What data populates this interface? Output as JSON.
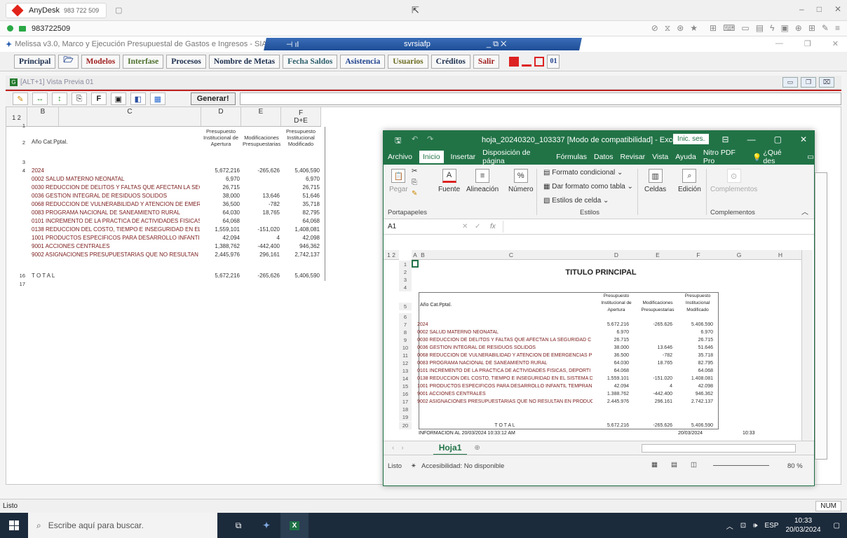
{
  "anydesk": {
    "app_name": "AnyDesk",
    "tab_id": "983 722 509",
    "session_id": "983722509"
  },
  "melissa": {
    "window_title": "Melissa v3.0, Marco y Ejecución Presupuestal de Gastos e Ingresos - SIAF  [compilación",
    "rdp_host": "svrsiafp",
    "menu": {
      "principal": "Principal",
      "modelos": "Modelos",
      "interfase": "Interfase",
      "procesos": "Procesos",
      "nombre_metas": "Nombre de Metas",
      "fecha_saldos": "Fecha Saldos",
      "asistencia": "Asistencia",
      "usuarios": "Usuarios",
      "creditos": "Créditos",
      "salir": "Salir",
      "badge": "01"
    },
    "inner_title": "[ALT+1] Vista Previa 01",
    "generate_button": "Generar!",
    "status": "Listo",
    "num_indicator": "NUM"
  },
  "grid": {
    "outline_levels": [
      "1",
      "2"
    ],
    "col_headers": {
      "b": "B",
      "c": "C",
      "d": "D",
      "e": "E",
      "f": "F",
      "f_sub": "D+E"
    },
    "header_labels": {
      "cat": "Año  Cat.Pptal.",
      "d": "Presupuesto Institucional de Apertura",
      "e": "Modificaciones Presupuestarias",
      "f": "Presupuesto Institucional Modificado"
    },
    "row_numbers": {
      "r1": "1",
      "r2": "2",
      "r3": "3",
      "r4": "4",
      "r16": "16",
      "r17": "17"
    },
    "rows": [
      {
        "code": "2024",
        "desc": "",
        "d": "5,672,216",
        "e": "-265,626",
        "f": "5,406,590"
      },
      {
        "code": "0002",
        "desc": "SALUD MATERNO NEONATAL",
        "d": "6,970",
        "e": "",
        "f": "6,970"
      },
      {
        "code": "0030",
        "desc": "REDUCCION DE DELITOS Y FALTAS QUE AFECTAN LA SEGUI",
        "d": "26,715",
        "e": "",
        "f": "26,715"
      },
      {
        "code": "0036",
        "desc": "GESTION INTEGRAL DE RESIDUOS SOLIDOS",
        "d": "38,000",
        "e": "13,646",
        "f": "51,646"
      },
      {
        "code": "0068",
        "desc": "REDUCCION DE VULNERABILIDAD Y ATENCION DE EMERGEN",
        "d": "36,500",
        "e": "-782",
        "f": "35,718"
      },
      {
        "code": "0083",
        "desc": "PROGRAMA NACIONAL DE SANEAMIENTO RURAL",
        "d": "64,030",
        "e": "18,765",
        "f": "82,795"
      },
      {
        "code": "0101",
        "desc": "INCREMENTO DE LA PRACTICA DE ACTIVIDADES FISICAS, DE",
        "d": "64,068",
        "e": "",
        "f": "64,068"
      },
      {
        "code": "0138",
        "desc": "REDUCCION DEL COSTO, TIEMPO E INSEGURIDAD EN EL SIS",
        "d": "1,559,101",
        "e": "-151,020",
        "f": "1,408,081"
      },
      {
        "code": "1001",
        "desc": "PRODUCTOS ESPECIFICOS PARA DESARROLLO INFANTIL TE",
        "d": "42,094",
        "e": "4",
        "f": "42,098"
      },
      {
        "code": "9001",
        "desc": "ACCIONES CENTRALES",
        "d": "1,388,762",
        "e": "-442,400",
        "f": "946,362"
      },
      {
        "code": "9002",
        "desc": "ASIGNACIONES PRESUPUESTARIAS QUE NO RESULTAN EN I",
        "d": "2,445,976",
        "e": "296,161",
        "f": "2,742,137"
      }
    ],
    "total": {
      "label": "T O T A L",
      "d": "5,672,216",
      "e": "-265,626",
      "f": "5,406,590"
    }
  },
  "excel": {
    "title": "hoja_20240320_103337  [Modo de compatibilidad]  -  Excel",
    "signin": "Inic. ses.",
    "tabs": [
      "Archivo",
      "Inicio",
      "Insertar",
      "Disposición de página",
      "Fórmulas",
      "Datos",
      "Revisar",
      "Vista",
      "Ayuda",
      "Nitro PDF Pro",
      "¿Qué des"
    ],
    "ribbon": {
      "pegar": "Pegar",
      "fuente": "Fuente",
      "alineacion": "Alineación",
      "numero": "Número",
      "formato_condicional": "Formato condicional",
      "dar_formato": "Dar formato como tabla",
      "estilos_celda": "Estilos de celda",
      "celdas": "Celdas",
      "edicion": "Edición",
      "complementos": "Complementos",
      "portapapeles": "Portapapeles",
      "estilos": "Estilos",
      "complementos_group": "Complementos"
    },
    "name_box": "A1",
    "fx": "fx",
    "outline_levels": [
      "1",
      "2"
    ],
    "columns": [
      "A",
      "B",
      "C",
      "D",
      "E",
      "F",
      "G",
      "H"
    ],
    "main_title": "TITULO PRINCIPAL",
    "header_labels": {
      "cat": "Año  Cat.Pptal.",
      "d": "Presupuesto Institucional de Apertura",
      "e": "Modificaciones Presupuestarias",
      "f": "Presupuesto Institucional Modificado"
    },
    "row_numbers": [
      "1",
      "2",
      "3",
      "4",
      "5",
      "6",
      "7",
      "8",
      "9",
      "10",
      "11",
      "12",
      "13",
      "14",
      "15",
      "16",
      "17",
      "18",
      "19",
      "20"
    ],
    "rows": [
      {
        "code": "2024",
        "desc": "",
        "d": "5.672.216",
        "e": "-265.626",
        "f": "5.406.590"
      },
      {
        "code": "0002",
        "desc": "SALUD MATERNO NEONATAL",
        "d": "6.970",
        "e": "",
        "f": "6.970"
      },
      {
        "code": "0030",
        "desc": "REDUCCION DE DELITOS Y FALTAS QUE AFECTAN LA SEGURIDAD C",
        "d": "26.715",
        "e": "",
        "f": "26.715"
      },
      {
        "code": "0036",
        "desc": "GESTION INTEGRAL DE RESIDUOS SOLIDOS",
        "d": "38.000",
        "e": "13.646",
        "f": "51.646"
      },
      {
        "code": "0068",
        "desc": "REDUCCION DE VULNERABILIDAD Y ATENCION DE EMERGENCIAS P",
        "d": "36.500",
        "e": "-782",
        "f": "35.718"
      },
      {
        "code": "0083",
        "desc": "PROGRAMA NACIONAL DE SANEAMIENTO RURAL",
        "d": "64.030",
        "e": "18.765",
        "f": "82.795"
      },
      {
        "code": "0101",
        "desc": "INCREMENTO DE LA PRACTICA DE ACTIVIDADES FISICAS, DEPORTI",
        "d": "64.068",
        "e": "",
        "f": "64.068"
      },
      {
        "code": "0138",
        "desc": "REDUCCION DEL COSTO, TIEMPO E INSEGURIDAD EN EL SISTEMA D",
        "d": "1.559.101",
        "e": "-151.020",
        "f": "1.408.081"
      },
      {
        "code": "1001",
        "desc": "PRODUCTOS ESPECIFICOS PARA DESARROLLO INFANTIL TEMPRAN",
        "d": "42.094",
        "e": "4",
        "f": "42.098"
      },
      {
        "code": "9001",
        "desc": "ACCIONES CENTRALES",
        "d": "1.388.762",
        "e": "-442.400",
        "f": "946.362"
      },
      {
        "code": "9002",
        "desc": "ASIGNACIONES PRESUPUESTARIAS QUE NO RESULTAN EN PRODUC",
        "d": "2.445.976",
        "e": "296.161",
        "f": "2.742.137"
      }
    ],
    "total": {
      "label": "T O T A L",
      "d": "5.672.216",
      "e": "-265.626",
      "f": "5.406.590"
    },
    "info": "INFORMACION AL 20/03/2024 10:33:12 AM",
    "info_date": "20/03/2024",
    "info_time": "10:33",
    "sheet_tab": "Hoja1",
    "status_ready": "Listo",
    "accessibility": "Accesibilidad: No disponible",
    "zoom": "80 %"
  },
  "taskbar": {
    "search_placeholder": "Escribe aquí para buscar.",
    "lang": "ESP",
    "time": "10:33",
    "date": "20/03/2024"
  }
}
